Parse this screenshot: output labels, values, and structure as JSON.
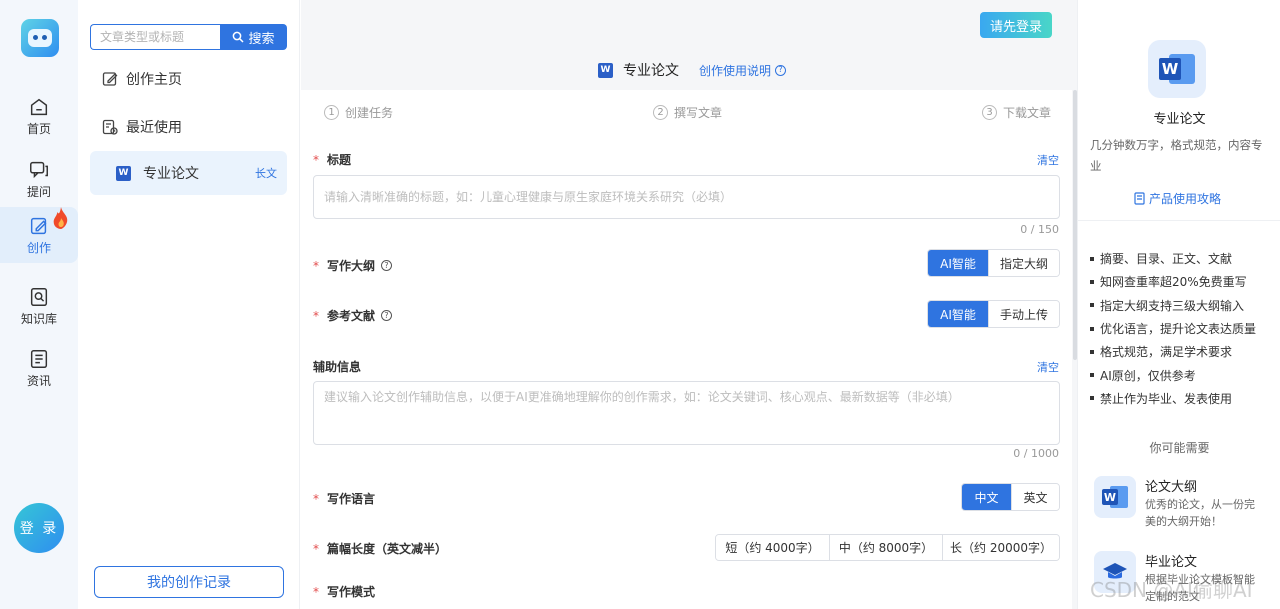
{
  "rail": {
    "items": [
      {
        "label": "首页",
        "icon": "home-icon"
      },
      {
        "label": "提问",
        "icon": "chat-icon"
      },
      {
        "label": "创作",
        "icon": "edit-icon"
      },
      {
        "label": "知识库",
        "icon": "knowledge-icon"
      },
      {
        "label": "资讯",
        "icon": "news-icon"
      }
    ],
    "login": "登 录"
  },
  "side": {
    "search_placeholder": "文章类型或标题",
    "search_button": "搜索",
    "create_home": "创作主页",
    "recent": "最近使用",
    "recent_item": {
      "label": "专业论文",
      "tag": "长文"
    },
    "history_button": "我的创作记录"
  },
  "main": {
    "login_button": "请先登录",
    "title": "专业论文",
    "help_link": "创作使用说明",
    "steps": [
      {
        "num": "1",
        "label": "创建任务"
      },
      {
        "num": "2",
        "label": "撰写文章"
      },
      {
        "num": "3",
        "label": "下载文章"
      }
    ],
    "title_field": {
      "label": "标题",
      "clear": "清空",
      "placeholder": "请输入清晰准确的标题，如：儿童心理健康与原生家庭环境关系研究（必填）",
      "counter": "0 / 150"
    },
    "outline": {
      "label": "写作大纲",
      "options": [
        "AI智能",
        "指定大纲"
      ],
      "selected": "AI智能"
    },
    "references": {
      "label": "参考文献",
      "options": [
        "AI智能",
        "手动上传"
      ],
      "selected": "AI智能"
    },
    "aux_field": {
      "label": "辅助信息",
      "clear": "清空",
      "placeholder": "建议输入论文创作辅助信息，以便于AI更准确地理解你的创作需求，如：论文关键词、核心观点、最新数据等（非必填）",
      "counter": "0 / 1000"
    },
    "language": {
      "label": "写作语言",
      "options": [
        "中文",
        "英文"
      ],
      "selected": "中文"
    },
    "length": {
      "label": "篇幅长度（英文减半）",
      "options": [
        "短（约 4000字）",
        "中（约 8000字）",
        "长（约 20000字）"
      ]
    },
    "mode": {
      "label": "写作模式"
    }
  },
  "right": {
    "title": "专业论文",
    "desc": "几分钟数万字，格式规范，内容专业",
    "guide": "产品使用攻略",
    "features": [
      "摘要、目录、正文、文献",
      "知网查重率超20%免费重写",
      "指定大纲支持三级大纲输入",
      "优化语言，提升论文表达质量",
      "格式规范，满足学术要求",
      "AI原创，仅供参考",
      "禁止作为毕业、发表使用"
    ],
    "maybe_title": "你可能需要",
    "recommendations": [
      {
        "name": "论文大纲",
        "desc": "优秀的论文，从一份完美的大纲开始！"
      },
      {
        "name": "毕业论文",
        "desc": "根据毕业论文模板智能定制的范文"
      }
    ]
  },
  "watermark": "CSDN @AI偷聊AI",
  "colors": {
    "accent": "#2f74e0",
    "required": "#e34d4d",
    "teal": "#49d6c8"
  }
}
